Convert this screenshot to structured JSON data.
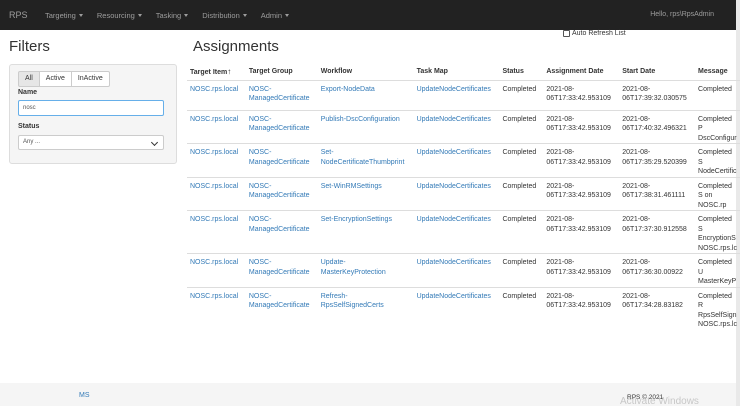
{
  "navbar": {
    "brand": "RPS",
    "items": [
      {
        "label": "Targeting"
      },
      {
        "label": "Resourcing"
      },
      {
        "label": "Tasking"
      },
      {
        "label": "Distribution"
      },
      {
        "label": "Admin"
      }
    ],
    "user": "Hello, rps\\RpsAdmin"
  },
  "filters": {
    "title": "Filters",
    "toggle": [
      "All",
      "Active",
      "InActive"
    ],
    "name_label": "Name",
    "name_value": "nosc",
    "status_label": "Status",
    "status_value": "Any ..."
  },
  "assignments": {
    "title": "Assignments",
    "auto_refresh_label": "Auto Refresh List",
    "columns": [
      "Target Item",
      "Target Group",
      "Workflow",
      "Task Map",
      "Status",
      "Assignment Date",
      "Start Date",
      "Message"
    ],
    "sort_icon": "↑",
    "rows": [
      {
        "target": "NOSC.rps.local",
        "group": "NOSC-ManagedCertificate",
        "workflow": "Export-NodeData",
        "task_map": "UpdateNodeCertificates",
        "status": "Completed",
        "assigned": "2021-08-06T17:33:42.953109",
        "start": "2021-08-06T17:39:32.030575",
        "message": "Completed"
      },
      {
        "target": "NOSC.rps.local",
        "group": "NOSC-ManagedCertificate",
        "workflow": "Publish-DscConfiguration",
        "task_map": "UpdateNodeCertificates",
        "status": "Completed",
        "assigned": "2021-08-06T17:33:42.953109",
        "start": "2021-08-06T17:40:32.496321",
        "message": "Completed P DscConfigur"
      },
      {
        "target": "NOSC.rps.local",
        "group": "NOSC-ManagedCertificate",
        "workflow": "Set-NodeCertificateThumbprint",
        "task_map": "UpdateNodeCertificates",
        "status": "Completed",
        "assigned": "2021-08-06T17:33:42.953109",
        "start": "2021-08-06T17:35:29.520399",
        "message": "Completed S NodeCertific"
      },
      {
        "target": "NOSC.rps.local",
        "group": "NOSC-ManagedCertificate",
        "workflow": "Set-WinRMSettings",
        "task_map": "UpdateNodeCertificates",
        "status": "Completed",
        "assigned": "2021-08-06T17:33:42.953109",
        "start": "2021-08-06T17:38:31.461111",
        "message": "Completed S on NOSC.rp"
      },
      {
        "target": "NOSC.rps.local",
        "group": "NOSC-ManagedCertificate",
        "workflow": "Set-EncryptionSettings",
        "task_map": "UpdateNodeCertificates",
        "status": "Completed",
        "assigned": "2021-08-06T17:33:42.953109",
        "start": "2021-08-06T17:37:30.912558",
        "message": "Completed S EncryptionS NOSC.rps.lc"
      },
      {
        "target": "NOSC.rps.local",
        "group": "NOSC-ManagedCertificate",
        "workflow": "Update-MasterKeyProtection",
        "task_map": "UpdateNodeCertificates",
        "status": "Completed",
        "assigned": "2021-08-06T17:33:42.953109",
        "start": "2021-08-06T17:36:30.00922",
        "message": "Completed U MasterKeyP"
      },
      {
        "target": "NOSC.rps.local",
        "group": "NOSC-ManagedCertificate",
        "workflow": "Refresh-RpsSelfSignedCerts",
        "task_map": "UpdateNodeCertificates",
        "status": "Completed",
        "assigned": "2021-08-06T17:33:42.953109",
        "start": "2021-08-06T17:34:28.83182",
        "message": "Completed R RpsSelfSign NOSC.rps.lc"
      }
    ]
  },
  "footer": {
    "left": "MS",
    "right": "RPS © 2021"
  },
  "watermark": "Activate Windows"
}
